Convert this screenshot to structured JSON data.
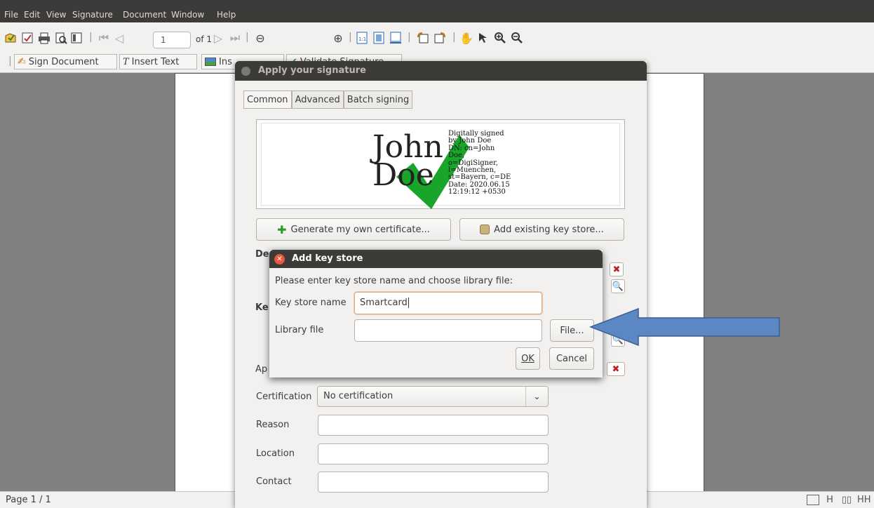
{
  "menu": {
    "items": [
      "File",
      "Edit",
      "View",
      "Signature",
      "Document",
      "Window",
      "Help"
    ]
  },
  "toolbar": {
    "page_number": "1",
    "page_of": "of 1",
    "sign_document": "Sign Document",
    "insert_text": "Insert Text",
    "insert_image": "Ins",
    "validate": "Validate Signature"
  },
  "status": {
    "page": "Page 1 / 1"
  },
  "apply_dialog": {
    "title": "Apply your signature",
    "tabs": [
      "Common",
      "Advanced",
      "Batch signing"
    ],
    "signature": {
      "name_line1": "John",
      "name_line2": "Doe",
      "details": "Digitally signed\nby John Doe\nDN: cn=John\nDoe,\no=DigiSigner,\nl=Muenchen,\nst=Bayern, c=DE\nDate: 2020.06.15\n12:19:12 +0530"
    },
    "generate_button": "Generate my own certificate...",
    "add_keystore_button": "Add existing key store...",
    "section_default_partial": "De",
    "section_key_partial": "Ke",
    "appearance_partial": "Ap",
    "certification_label": "Certification",
    "certification_value": "No certification",
    "reason_label": "Reason",
    "location_label": "Location",
    "contact_label": "Contact"
  },
  "keystore_dialog": {
    "title": "Add key store",
    "prompt": "Please enter key store name and choose library file:",
    "name_label": "Key store name",
    "name_value": "Smartcard",
    "library_label": "Library file",
    "library_value": "",
    "file_button": "File...",
    "ok_button": "OK",
    "cancel_button": "Cancel"
  },
  "colors": {
    "accent": "#e9573f",
    "titlebar": "#3c3b37",
    "arrow": "#5b87c4"
  }
}
